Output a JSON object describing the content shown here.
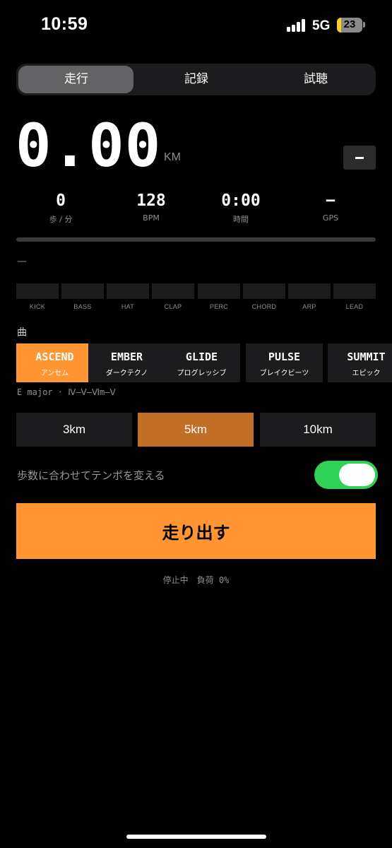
{
  "status_bar": {
    "time": "10:59",
    "network": "5G",
    "battery_level": "23",
    "battery_color": "#f7d21b"
  },
  "tabs": [
    {
      "label": "走行",
      "active": true
    },
    {
      "label": "記録",
      "active": false
    },
    {
      "label": "試聴",
      "active": false
    }
  ],
  "distance": {
    "value": "0.00",
    "unit": "KM",
    "minus_label": "−"
  },
  "stats": [
    {
      "value": "0",
      "label": "歩 / 分"
    },
    {
      "value": "128",
      "label": "BPM"
    },
    {
      "value": "0:00",
      "label": "時間"
    },
    {
      "value": "−",
      "label": "GPS"
    }
  ],
  "progress": 0.0,
  "section_dash": "—",
  "tracks": [
    "KICK",
    "BASS",
    "HAT",
    "CLAP",
    "PERC",
    "CHORD",
    "ARP",
    "LEAD"
  ],
  "song_section_label": "曲",
  "songs": [
    {
      "title": "ASCEND",
      "subtitle": "アンセム",
      "active": true
    },
    {
      "title": "EMBER",
      "subtitle": "ダークテクノ",
      "active": false
    },
    {
      "title": "GLIDE",
      "subtitle": "プログレッシブ",
      "active": false
    },
    {
      "title": "PULSE",
      "subtitle": "ブレイクビーツ",
      "active": false
    },
    {
      "title": "SUMMIT",
      "subtitle": "エピック",
      "active": false
    }
  ],
  "key_info": "E major · Ⅳ–Ⅴ–Ⅵm–Ⅴ",
  "goals": [
    {
      "label": "3km",
      "active": false
    },
    {
      "label": "5km",
      "active": true
    },
    {
      "label": "10km",
      "active": false
    }
  ],
  "tempo_toggle": {
    "label": "歩数に合わせてテンポを変える",
    "on": true
  },
  "start_button": "走り出す",
  "status_line": "停止中　負荷 0%",
  "colors": {
    "accent": "#ff9533",
    "accent_dim": "#c26f26",
    "toggle_on": "#30d158"
  }
}
